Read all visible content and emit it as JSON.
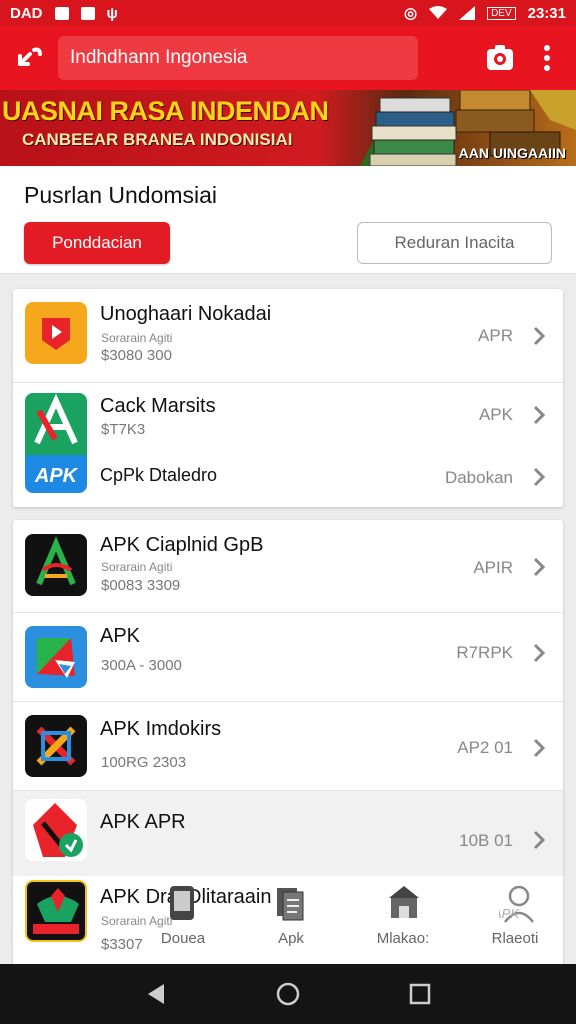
{
  "status_bar": {
    "left_text": "DAD",
    "battery": "DEV",
    "time": "23:31"
  },
  "app_bar": {
    "search_value": "Indhdhann Ingonesia"
  },
  "banner": {
    "title": "UASNAI RASA INDENDAN",
    "subtitle": "CANBEEAR BRANEA INDONISIAI",
    "badge": "AAN UINGAAIIN"
  },
  "section": {
    "heading": "Pusrlan Undomsiai",
    "primary_button": "Ponddacian",
    "secondary_button": "Reduran Inacita"
  },
  "list_group_1": [
    {
      "name": "Unoghaari Nokadai",
      "sub": "Sorarain Agiti",
      "meta": "$3080 300",
      "tag": "APR",
      "icon": "youtube-play-icon"
    },
    {
      "name": "Cack Marsits",
      "meta": "$T7K3",
      "tag": "APK",
      "icon": "apk-a-icon"
    },
    {
      "name": "CpPk Dtaledro",
      "tag": "Dabokan",
      "icon": "apk-badge-icon"
    }
  ],
  "list_group_2": [
    {
      "name": "APK Ciaplnid GpB",
      "sub": "Sorarain Agiti",
      "meta": "$0083 3309",
      "tag": "APIR",
      "icon": "green-a-icon"
    },
    {
      "name": "APK",
      "meta": "300A - 3000",
      "tag": "R7RPK",
      "icon": "google-play-icon"
    },
    {
      "name": "APK Imdokirs",
      "meta": "100RG 2303",
      "tag": "AP2 01",
      "icon": "x-cross-icon"
    },
    {
      "name": "APK APR",
      "tag": "10B 01",
      "icon": "red-shield-icon"
    },
    {
      "name": "APK Dra",
      "sub": "Sorarain Agiti",
      "meta": "$3307",
      "icon": "garuda-apk-icon"
    }
  ],
  "bottom_nav": [
    {
      "label": "Douea",
      "icon": "phone-icon"
    },
    {
      "label": "Apk",
      "icon": "documents-icon"
    },
    {
      "label": "Mlakao:",
      "icon": "store-icon"
    },
    {
      "label": "Rlaeoti",
      "icon": "user-apk-icon"
    }
  ],
  "app_text_overlap": "Dlitaraain",
  "colors": {
    "brand_red": "#e8141f",
    "button_red": "#e21b25",
    "banner_yellow": "#ffd21a",
    "system_nav": "#141414"
  }
}
